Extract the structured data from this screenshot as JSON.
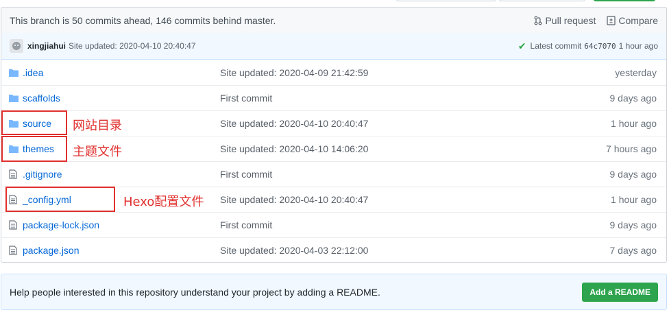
{
  "branch_bar": {
    "status": "This branch is 50 commits ahead, 146 commits behind master.",
    "pull_request_label": "Pull request",
    "compare_label": "Compare"
  },
  "commit_tease": {
    "author": "xingjiahui",
    "message": "Site updated: 2020-04-10 20:40:47",
    "latest_label": "Latest commit",
    "sha": "64c7070",
    "age": "1 hour ago"
  },
  "files": [
    {
      "type": "folder",
      "name": ".idea",
      "message": "Site updated: 2020-04-09 21:42:59",
      "age": "yesterday"
    },
    {
      "type": "folder",
      "name": "scaffolds",
      "message": "First commit",
      "age": "9 days ago"
    },
    {
      "type": "folder",
      "name": "source",
      "message": "Site updated: 2020-04-10 20:40:47",
      "age": "1 hour ago"
    },
    {
      "type": "folder",
      "name": "themes",
      "message": "Site updated: 2020-04-10 14:06:20",
      "age": "7 hours ago"
    },
    {
      "type": "file",
      "name": ".gitignore",
      "message": "First commit",
      "age": "9 days ago"
    },
    {
      "type": "file",
      "name": "_config.yml",
      "message": "Site updated: 2020-04-10 20:40:47",
      "age": "1 hour ago"
    },
    {
      "type": "file",
      "name": "package-lock.json",
      "message": "First commit",
      "age": "9 days ago"
    },
    {
      "type": "file",
      "name": "package.json",
      "message": "Site updated: 2020-04-03 22:12:00",
      "age": "7 days ago"
    }
  ],
  "annotations": {
    "source": "网站目录",
    "themes": "主题文件",
    "config": "Hexo配置文件"
  },
  "readme": {
    "text": "Help people interested in this repository understand your project by adding a README.",
    "button": "Add a README"
  },
  "colors": {
    "link": "#0366d6",
    "annotation": "#e0302d",
    "success": "#28a745",
    "folder": "#79b8ff"
  }
}
